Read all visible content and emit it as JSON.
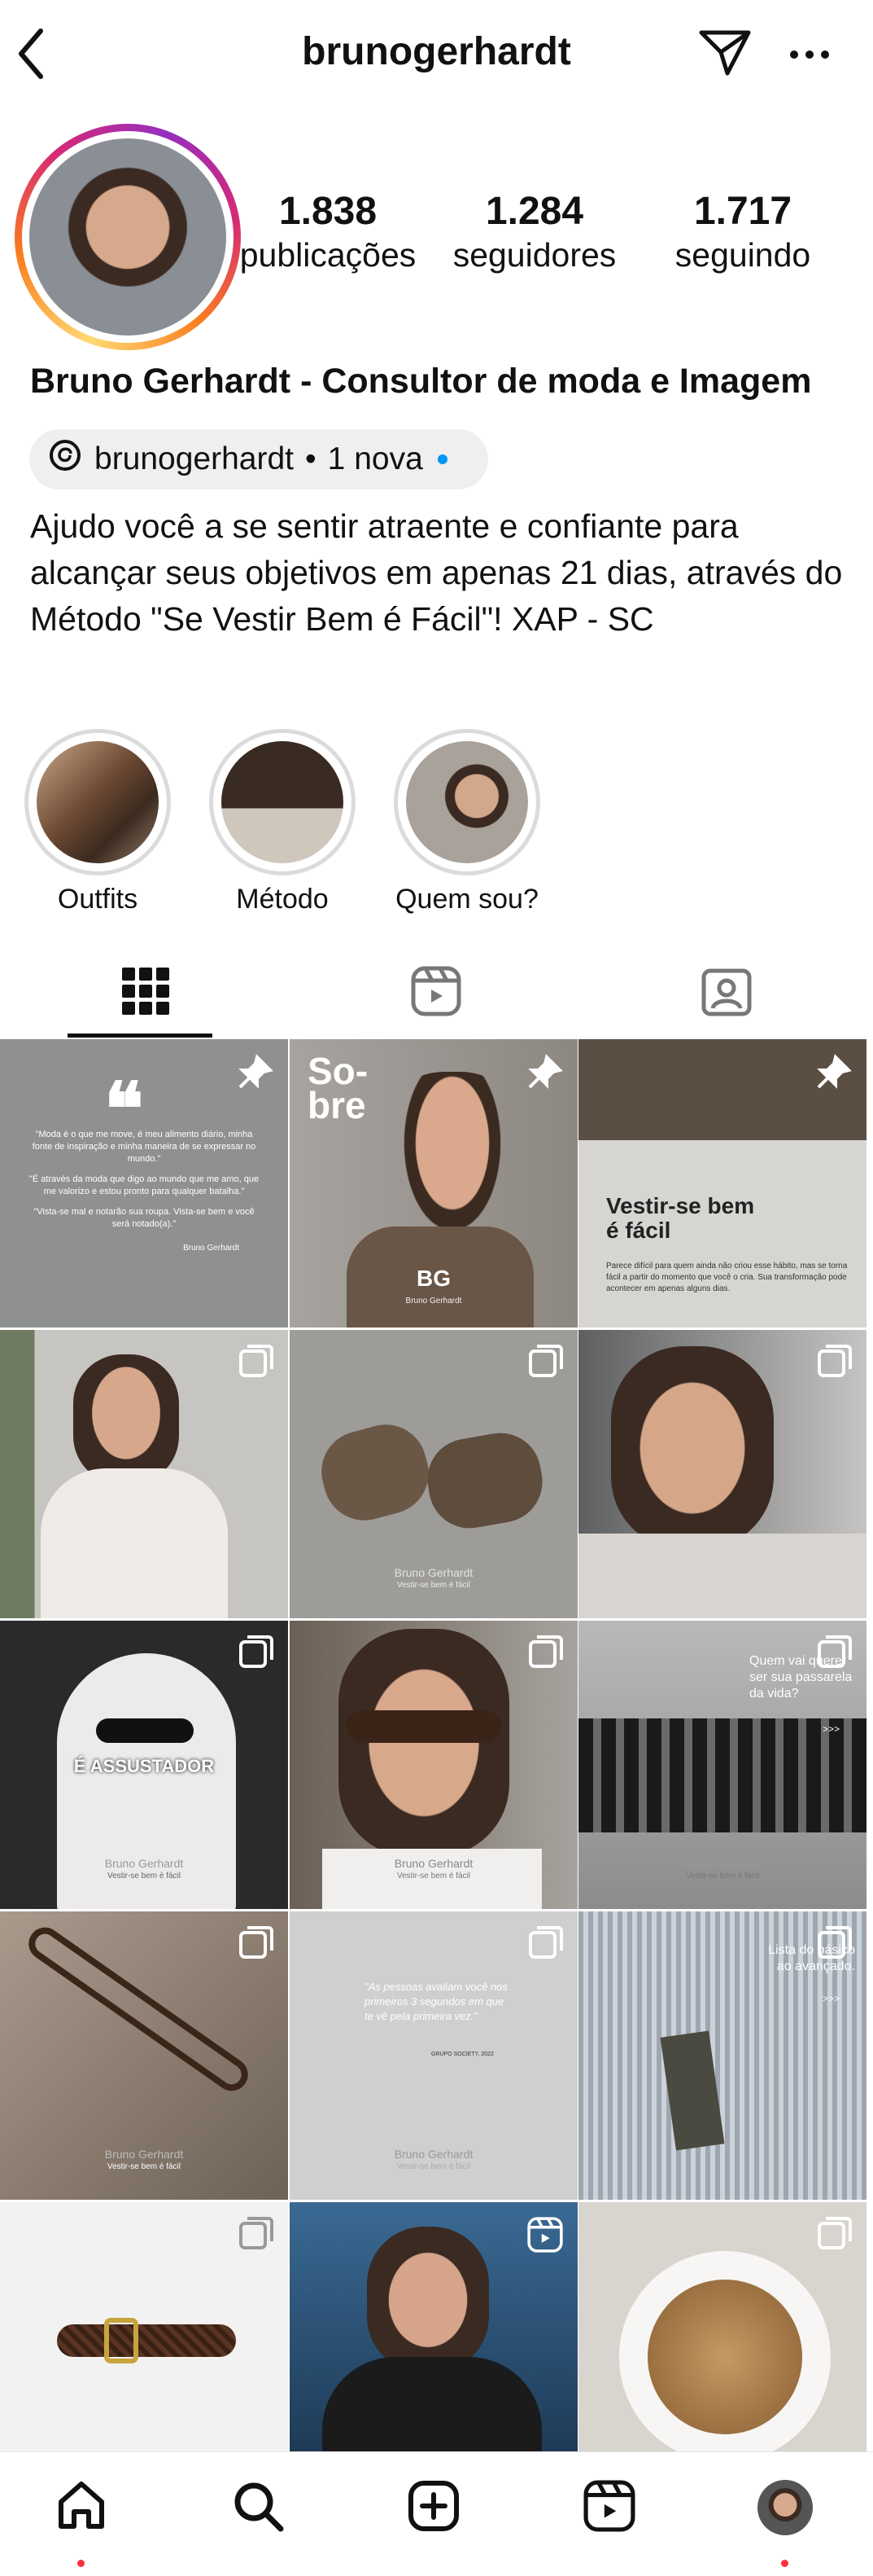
{
  "header": {
    "username": "brunogerhardt",
    "icons": [
      "back-icon",
      "send-icon",
      "more-icon"
    ]
  },
  "stats": [
    {
      "value": "1.838",
      "label": "publicações"
    },
    {
      "value": "1.284",
      "label": "seguidores"
    },
    {
      "value": "1.717",
      "label": "seguindo"
    }
  ],
  "profile": {
    "full_name": "Bruno Gerhardt - Consultor de moda e Imagem",
    "threads_handle": "brunogerhardt",
    "threads_new": "1 nova",
    "bio": "Ajudo você a se sentir atraente e confiante para alcançar seus objetivos em apenas 21 dias, através do Método \"Se Vestir Bem é Fácil\"! XAP - SC"
  },
  "highlights": [
    {
      "label": "Outfits"
    },
    {
      "label": "Método"
    },
    {
      "label": "Quem sou?"
    }
  ],
  "posts": {
    "p1_text": "\"Moda é o que me move, é meu alimento diário, minha fonte de inspiração e minha maneira de se expressar no mundo.\"",
    "p1_text2": "\"É através da moda que digo ao mundo que me amo, que me valorizo e estou pronto para qualquer batalha.\"",
    "p1_text3": "\"Vista-se mal e notarão sua roupa. Vista-se bem e você será notado(a).\"",
    "p1_sign": "Bruno Gerhardt",
    "p2_title": "So-bre",
    "p2_mono": "BG",
    "p2_name": "Bruno Gerhardt",
    "p3_title": "Vestir-se bem é fácil",
    "p3_text": "Parece difícil para quem ainda não criou esse hábito, mas se torna fácil a partir do momento que você o cria. Sua transformação pode acontecer em apenas alguns dias.",
    "brand_name": "Bruno Gerhardt",
    "brand_tag": "Vestir-se bem é fácil",
    "p7_title": "É ASSUSTADOR",
    "p9_title": "Quem vai querer ser sua passarela da vida?",
    "p11_quote": "\"As pessoas avaliam você nos primeiros 3 segundos em que te vê pela primeira vez.\"",
    "p11_source": "GRUPO SOCIETY, 2022",
    "p12_title": "Lista do básico ao avançado.",
    "arrows": ">>>"
  },
  "navbar": [
    "home-icon",
    "search-icon",
    "create-icon",
    "reels-icon",
    "profile-avatar"
  ],
  "colors": {
    "accent_dot": "#0095f6",
    "notif_dot": "#ff3040"
  }
}
